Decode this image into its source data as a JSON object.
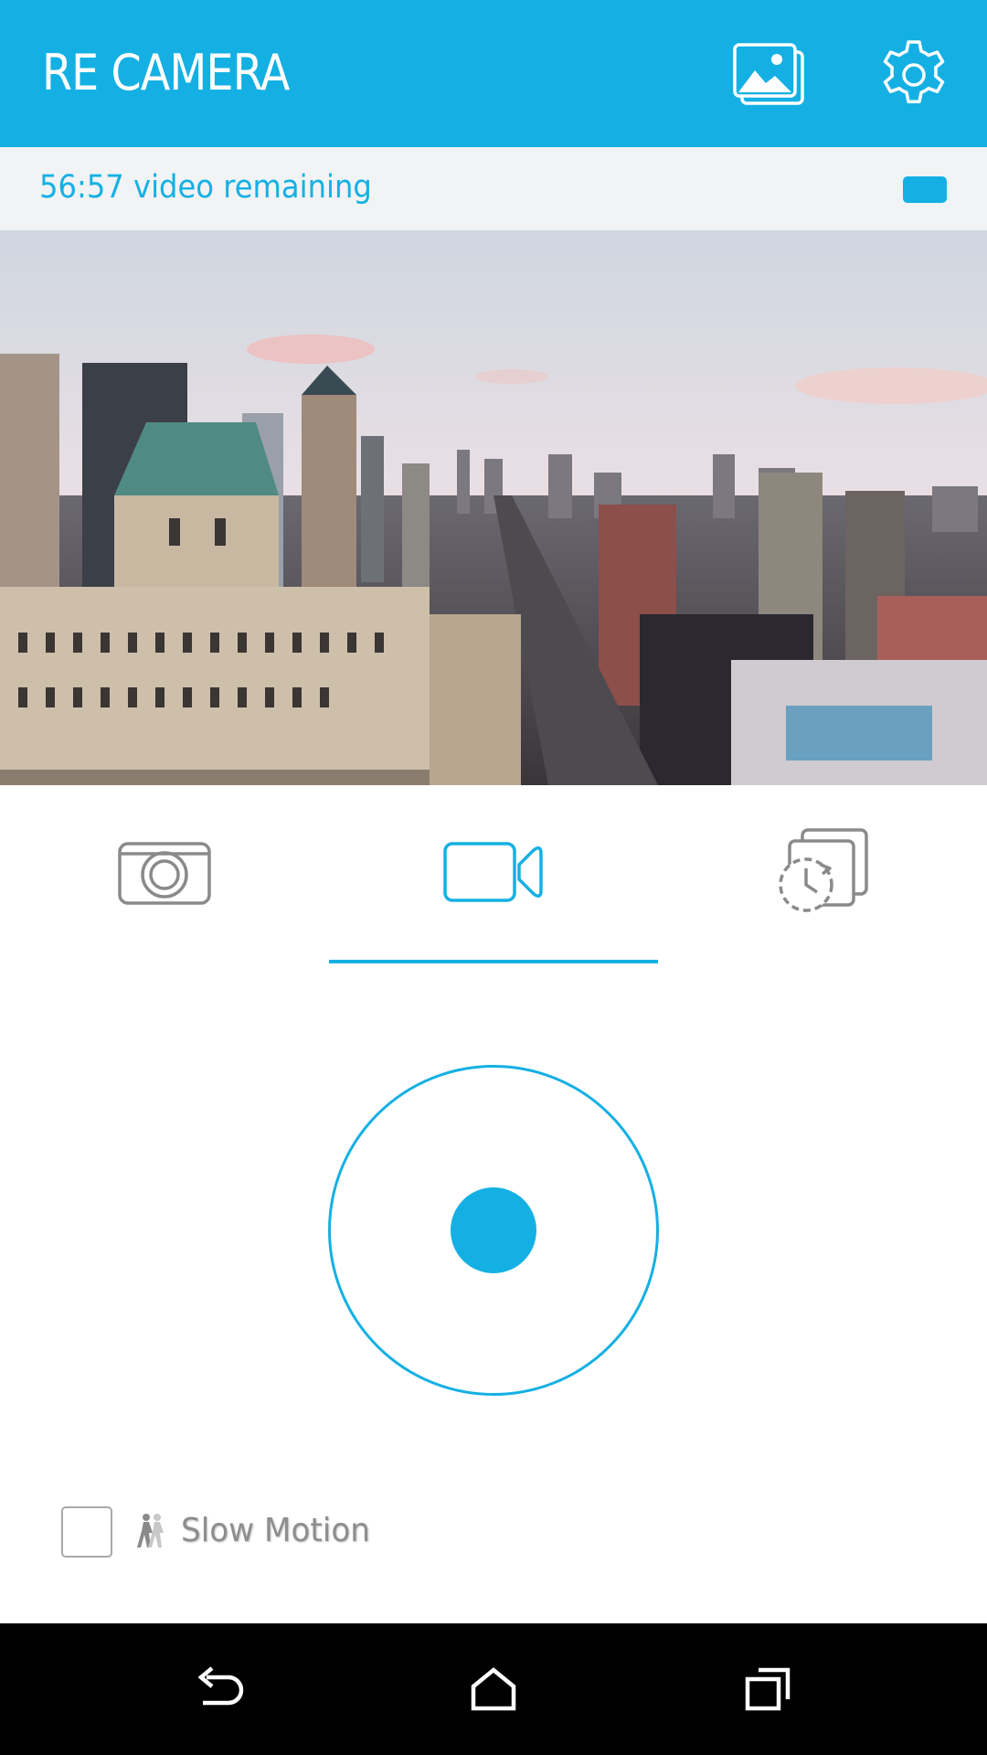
{
  "app_bar": {
    "title": "RE CAMERA",
    "background_color": "#14b0e4",
    "actions": [
      {
        "icon": "gallery-icon"
      },
      {
        "icon": "gear-icon"
      }
    ]
  },
  "status": {
    "remaining_text": "56:57 video remaining",
    "battery_icon": "battery-icon",
    "text_color": "#14b0e4"
  },
  "preview": {
    "subject": "city-skyline-preview"
  },
  "modes": {
    "items": [
      {
        "icon": "camera-icon",
        "selected": false
      },
      {
        "icon": "video-camera-icon",
        "selected": true
      },
      {
        "icon": "timelapse-icon",
        "selected": false
      }
    ],
    "accent_color": "#14b0e4"
  },
  "shutter": {
    "icon": "record-icon"
  },
  "slow_motion": {
    "label": "Slow Motion",
    "checked": false,
    "icon": "slow-motion-icon"
  },
  "nav_bar": {
    "items": [
      {
        "icon": "back-icon"
      },
      {
        "icon": "home-icon"
      },
      {
        "icon": "recents-icon"
      }
    ]
  }
}
